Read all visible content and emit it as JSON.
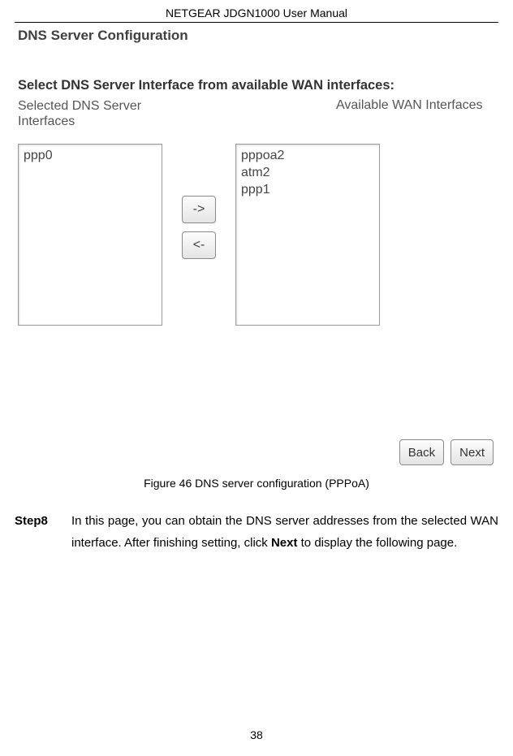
{
  "header": {
    "title": "NETGEAR JDGN1000 User Manual"
  },
  "config": {
    "heading": "DNS Server Configuration",
    "prompt": "Select DNS Server Interface from available WAN interfaces:",
    "left_label": "Selected DNS Server Interfaces",
    "right_label": "Available WAN Interfaces",
    "selected": [
      "ppp0"
    ],
    "available": [
      "pppoa2",
      "atm2",
      "ppp1"
    ],
    "arrow_right": "->",
    "arrow_left": "<-",
    "back": "Back",
    "next": "Next"
  },
  "caption": "Figure 46 DNS server configuration (PPPoA)",
  "step": {
    "label": "Step8",
    "text_pre": "In this page, you can obtain the DNS server addresses from the selected WAN interface. After finishing setting, click ",
    "text_bold": "Next",
    "text_post": " to display the following page."
  },
  "page_number": "38"
}
